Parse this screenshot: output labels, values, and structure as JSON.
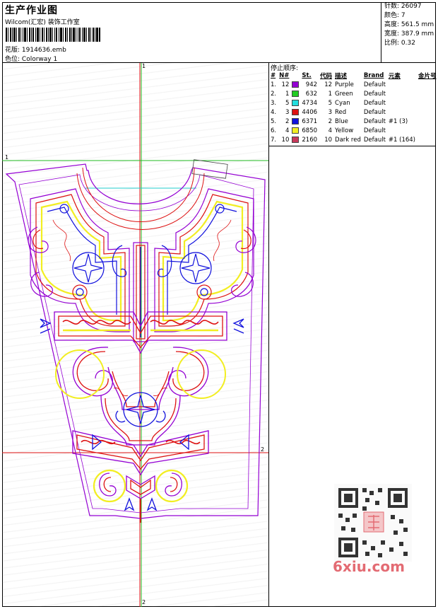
{
  "header": {
    "title": "生产作业图",
    "studio": "Wilcom(汇宏) 装饰工作室",
    "design_label": "花版:",
    "design_file": "1914636.emb",
    "color_label": "色位:",
    "colorway": "Colorway 1"
  },
  "stats": [
    {
      "label": "针数:",
      "value": "26097"
    },
    {
      "label": "颜色:",
      "value": "7"
    },
    {
      "label": "高度:",
      "value": "561.5 mm"
    },
    {
      "label": "宽度:",
      "value": "387.9 mm"
    },
    {
      "label": "比例:",
      "value": "0.32"
    }
  ],
  "sequence": {
    "title": "停止顺序:",
    "columns": [
      "#",
      "N#",
      "St.",
      "代码",
      "描述",
      "Brand",
      "元素",
      "金片号"
    ],
    "rows": [
      {
        "idx": "1.",
        "n": "12",
        "color": "#9400d3",
        "st": "942",
        "code": "12",
        "desc": "Purple",
        "brand": "Default",
        "elem": "",
        "sequin": ""
      },
      {
        "idx": "2.",
        "n": "1",
        "color": "#22cc22",
        "st": "632",
        "code": "1",
        "desc": "Green",
        "brand": "Default",
        "elem": "",
        "sequin": ""
      },
      {
        "idx": "3.",
        "n": "5",
        "color": "#22dddd",
        "st": "4734",
        "code": "5",
        "desc": "Cyan",
        "brand": "Default",
        "elem": "",
        "sequin": ""
      },
      {
        "idx": "4.",
        "n": "3",
        "color": "#dd1111",
        "st": "4406",
        "code": "3",
        "desc": "Red",
        "brand": "Default",
        "elem": "",
        "sequin": ""
      },
      {
        "idx": "5.",
        "n": "2",
        "color": "#1111dd",
        "st": "6371",
        "code": "2",
        "desc": "Blue",
        "brand": "Default",
        "elem": "#1 (3)",
        "sequin": ""
      },
      {
        "idx": "6.",
        "n": "4",
        "color": "#f2ee22",
        "st": "6850",
        "code": "4",
        "desc": "Yellow",
        "brand": "Default",
        "elem": "",
        "sequin": ""
      },
      {
        "idx": "7.",
        "n": "10",
        "color": "#c8385a",
        "st": "2160",
        "code": "10",
        "desc": "Dark red",
        "brand": "Default",
        "elem": "#1 (164)",
        "sequin": ""
      }
    ]
  },
  "guides": {
    "v1": "1",
    "h1": "1",
    "h2": "2",
    "v2": "2"
  },
  "watermark": {
    "brand": "6xiu.com"
  },
  "colors": {
    "purple": "#9400d3",
    "red": "#dd1111",
    "blue": "#1111dd",
    "yellow": "#f2ee22",
    "green": "#22cc22",
    "cyan": "#22dddd",
    "darkred": "#c8385a"
  }
}
